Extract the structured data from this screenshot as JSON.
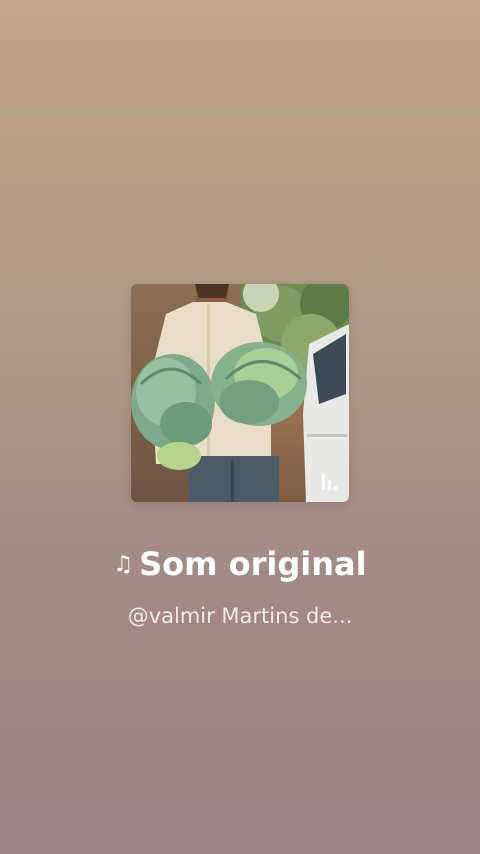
{
  "sound": {
    "title": "Som original",
    "author": "@valmir Martins de..."
  },
  "icons": {
    "title_icon": "music-note-icon",
    "cover_badge": "audio-bars-icon"
  },
  "colors": {
    "background_top": "#c2a68a",
    "background_bottom": "#9c8187",
    "text": "#ffffff"
  }
}
